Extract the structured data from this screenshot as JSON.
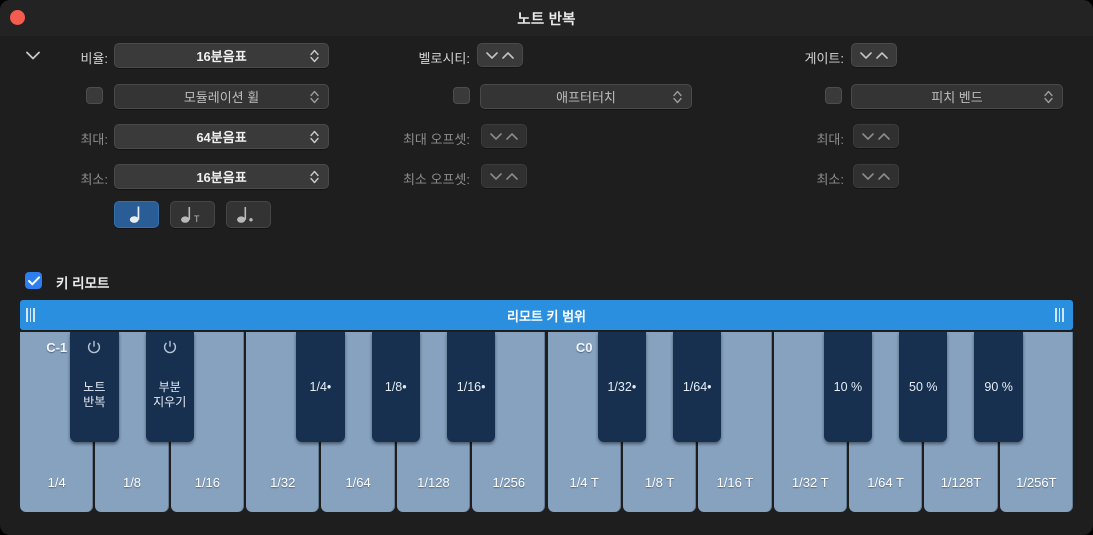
{
  "window": {
    "title": "노트 반복",
    "close_button": "close"
  },
  "params": {
    "disclosure_icon": "chevron-down-icon",
    "left": {
      "rate_label": "비율:",
      "rate_value": "16분음표",
      "source_checkbox_checked": false,
      "source_value": "모듈레이션 휠",
      "max_label": "최대:",
      "max_value": "64분음표",
      "min_label": "최소:",
      "min_value": "16분음표",
      "note_buttons": [
        {
          "id": "note-straight",
          "glyph": "note",
          "selected": true
        },
        {
          "id": "note-triplet",
          "glyph": "note-triplet",
          "selected": false
        },
        {
          "id": "note-dotted",
          "glyph": "note-dotted",
          "selected": false
        }
      ]
    },
    "middle": {
      "velocity_label": "벨로시티:",
      "source_checkbox_checked": false,
      "source_value": "애프터터치",
      "max_offset_label": "최대 오프셋:",
      "min_offset_label": "최소 오프셋:"
    },
    "right": {
      "gate_label": "게이트:",
      "source_checkbox_checked": false,
      "source_value": "피치 벤드",
      "max_label": "최대:",
      "min_label": "최소:"
    }
  },
  "key_remote": {
    "checkbox_checked": true,
    "label": "키 리모트",
    "range_bar_label": "리모트 키 범위",
    "white_keys": [
      {
        "label": "1/4",
        "octave": "C-1"
      },
      {
        "label": "1/8",
        "octave": ""
      },
      {
        "label": "1/16",
        "octave": ""
      },
      {
        "label": "1/32",
        "octave": ""
      },
      {
        "label": "1/64",
        "octave": ""
      },
      {
        "label": "1/128",
        "octave": ""
      },
      {
        "label": "1/256",
        "octave": ""
      },
      {
        "label": "1/4 T",
        "octave": "C0"
      },
      {
        "label": "1/8 T",
        "octave": ""
      },
      {
        "label": "1/16 T",
        "octave": ""
      },
      {
        "label": "1/32 T",
        "octave": ""
      },
      {
        "label": "1/64 T",
        "octave": ""
      },
      {
        "label": "1/128T",
        "octave": ""
      },
      {
        "label": "1/256T",
        "octave": ""
      }
    ],
    "black_keys": [
      {
        "after": 0,
        "line1": "노트",
        "line2": "반복",
        "icon": "power-icon"
      },
      {
        "after": 1,
        "line1": "부분",
        "line2": "지우기",
        "icon": "power-icon"
      },
      {
        "after": 3,
        "line1": "1/4•",
        "line2": "",
        "icon": ""
      },
      {
        "after": 4,
        "line1": "1/8•",
        "line2": "",
        "icon": ""
      },
      {
        "after": 5,
        "line1": "1/16•",
        "line2": "",
        "icon": ""
      },
      {
        "after": 7,
        "line1": "1/32•",
        "line2": "",
        "icon": ""
      },
      {
        "after": 8,
        "line1": "1/64•",
        "line2": "",
        "icon": ""
      },
      {
        "after": 10,
        "line1": "10 %",
        "line2": "",
        "icon": ""
      },
      {
        "after": 11,
        "line1": "50 %",
        "line2": "",
        "icon": ""
      },
      {
        "after": 12,
        "line1": "90 %",
        "line2": "",
        "icon": ""
      }
    ]
  },
  "colors": {
    "accent": "#2d7ff0",
    "range_bar": "#2b8fe0",
    "white_key": "#86a2bf",
    "black_key": "#17304f",
    "window_bg": "#1e1e1e",
    "close": "#f35c4e"
  }
}
